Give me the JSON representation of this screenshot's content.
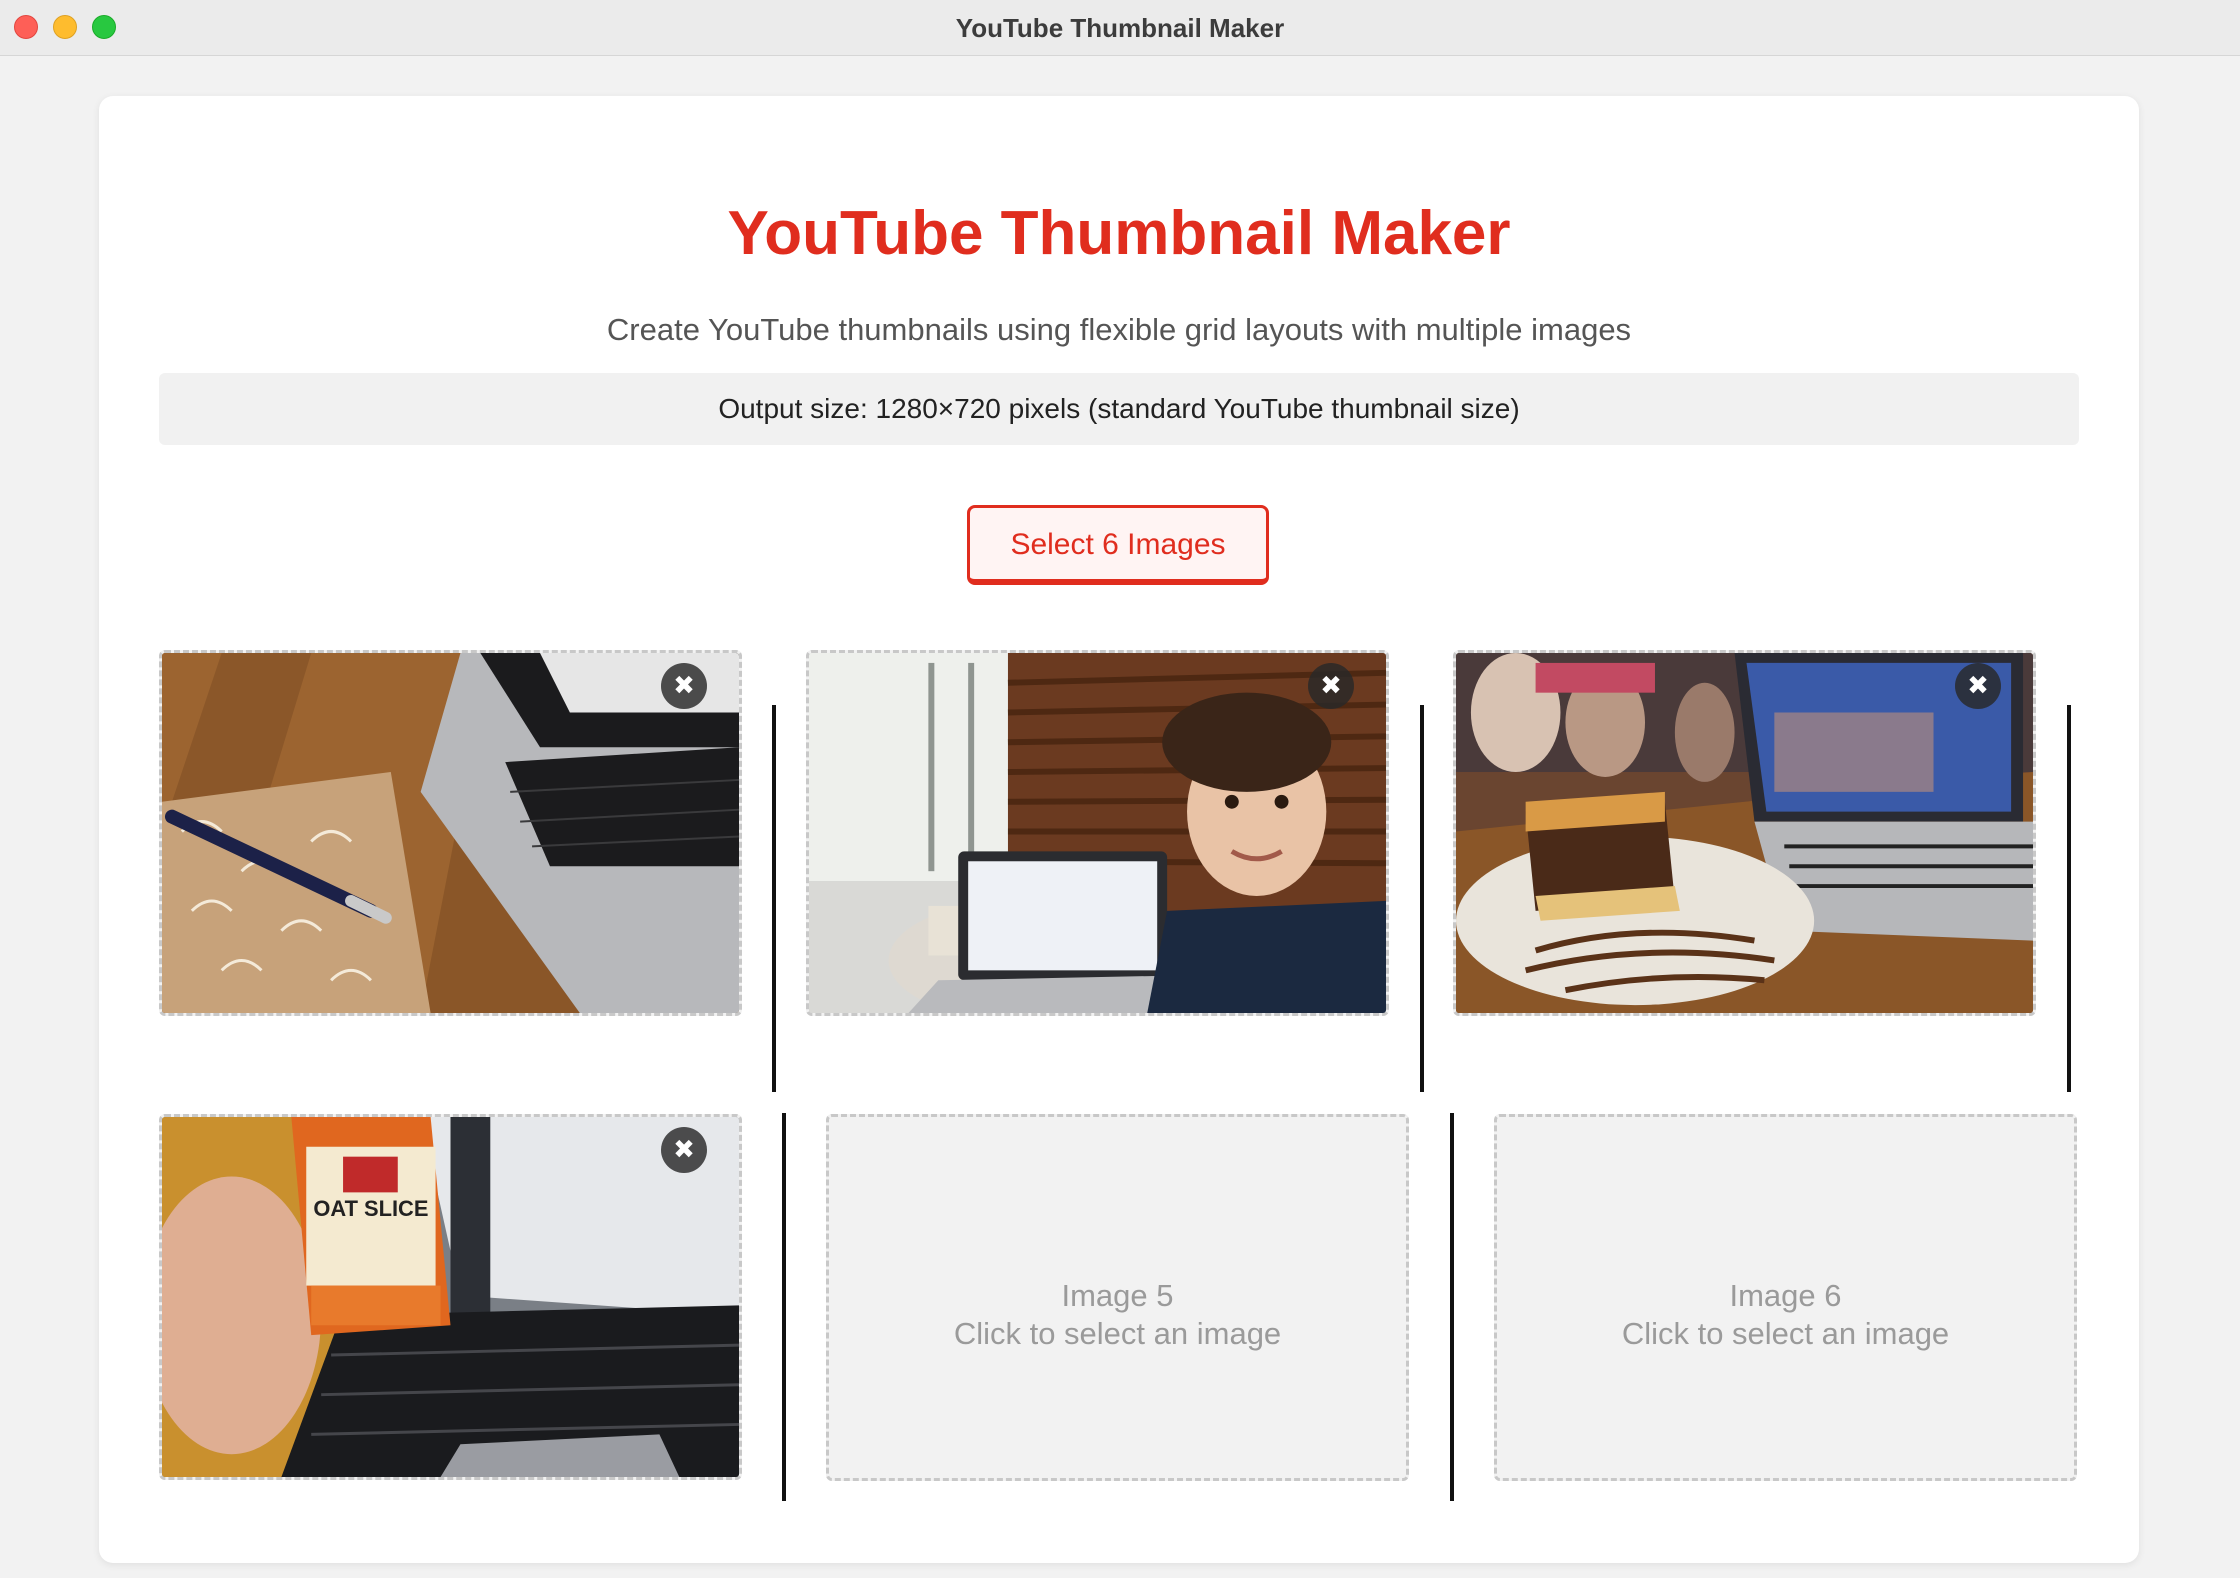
{
  "window": {
    "title": "YouTube Thumbnail Maker"
  },
  "header": {
    "title": "YouTube Thumbnail Maker",
    "subtitle": "Create YouTube thumbnails using flexible grid layouts with multiple images"
  },
  "info": {
    "output_size_text": "Output size: 1280×720 pixels (standard YouTube thumbnail size)"
  },
  "actions": {
    "select_label": "Select 6 Images"
  },
  "slots": [
    {
      "filled": true,
      "scene": "notebook, pen and laptop on wooden table"
    },
    {
      "filled": true,
      "scene": "selfie of young man with laptop in cafe"
    },
    {
      "filled": true,
      "scene": "chocolate caramel slice on plate beside laptop"
    },
    {
      "filled": true,
      "scene": "hand holding oat slice snack bar over laptop keyboard",
      "package_text": "OAT SLICE"
    },
    {
      "filled": false,
      "title": "Image 5",
      "hint": "Click to select an image"
    },
    {
      "filled": false,
      "title": "Image 6",
      "hint": "Click to select an image"
    }
  ],
  "remove_glyph": "✖",
  "colors": {
    "accent": "#e02d1e",
    "placeholder_bg": "#f2f2f2",
    "divider": "#111111"
  }
}
